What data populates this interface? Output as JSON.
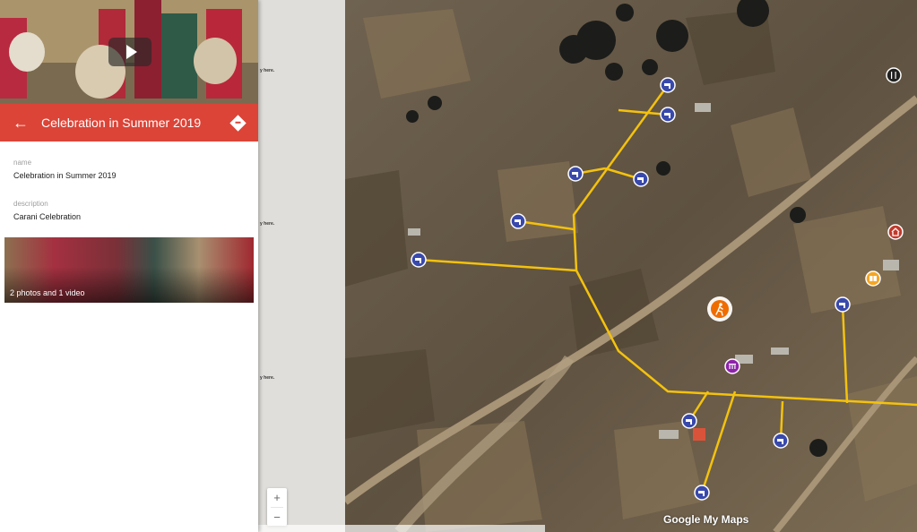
{
  "feature": {
    "title": "Celebration in Summer 2019",
    "name_label": "name",
    "name_value": "Celebration in Summer 2019",
    "description_label": "description",
    "description_value": "Carani Celebration",
    "gallery_caption": "2 photos and 1 video"
  },
  "map": {
    "strip_text": "y here.",
    "zoom_in": "+",
    "zoom_out": "−",
    "logo": "Google My Maps"
  },
  "icons": {
    "back": "arrow-left-icon",
    "directions": "directions-icon",
    "play": "play-icon",
    "water": "water-tap-icon",
    "hiking": "hiking-icon",
    "museum": "museum-icon",
    "home": "home-icon",
    "book": "book-icon",
    "restaurant": "restaurant-icon"
  },
  "colors": {
    "header": "#db4437",
    "water_marker": "#3949ab",
    "pipeline": "#f4c20d",
    "hiking_marker": "#ef6c00",
    "museum_marker": "#8e24aa",
    "home_marker": "#c0392b",
    "book_marker": "#f5a623",
    "restaurant_marker": "#212121"
  }
}
